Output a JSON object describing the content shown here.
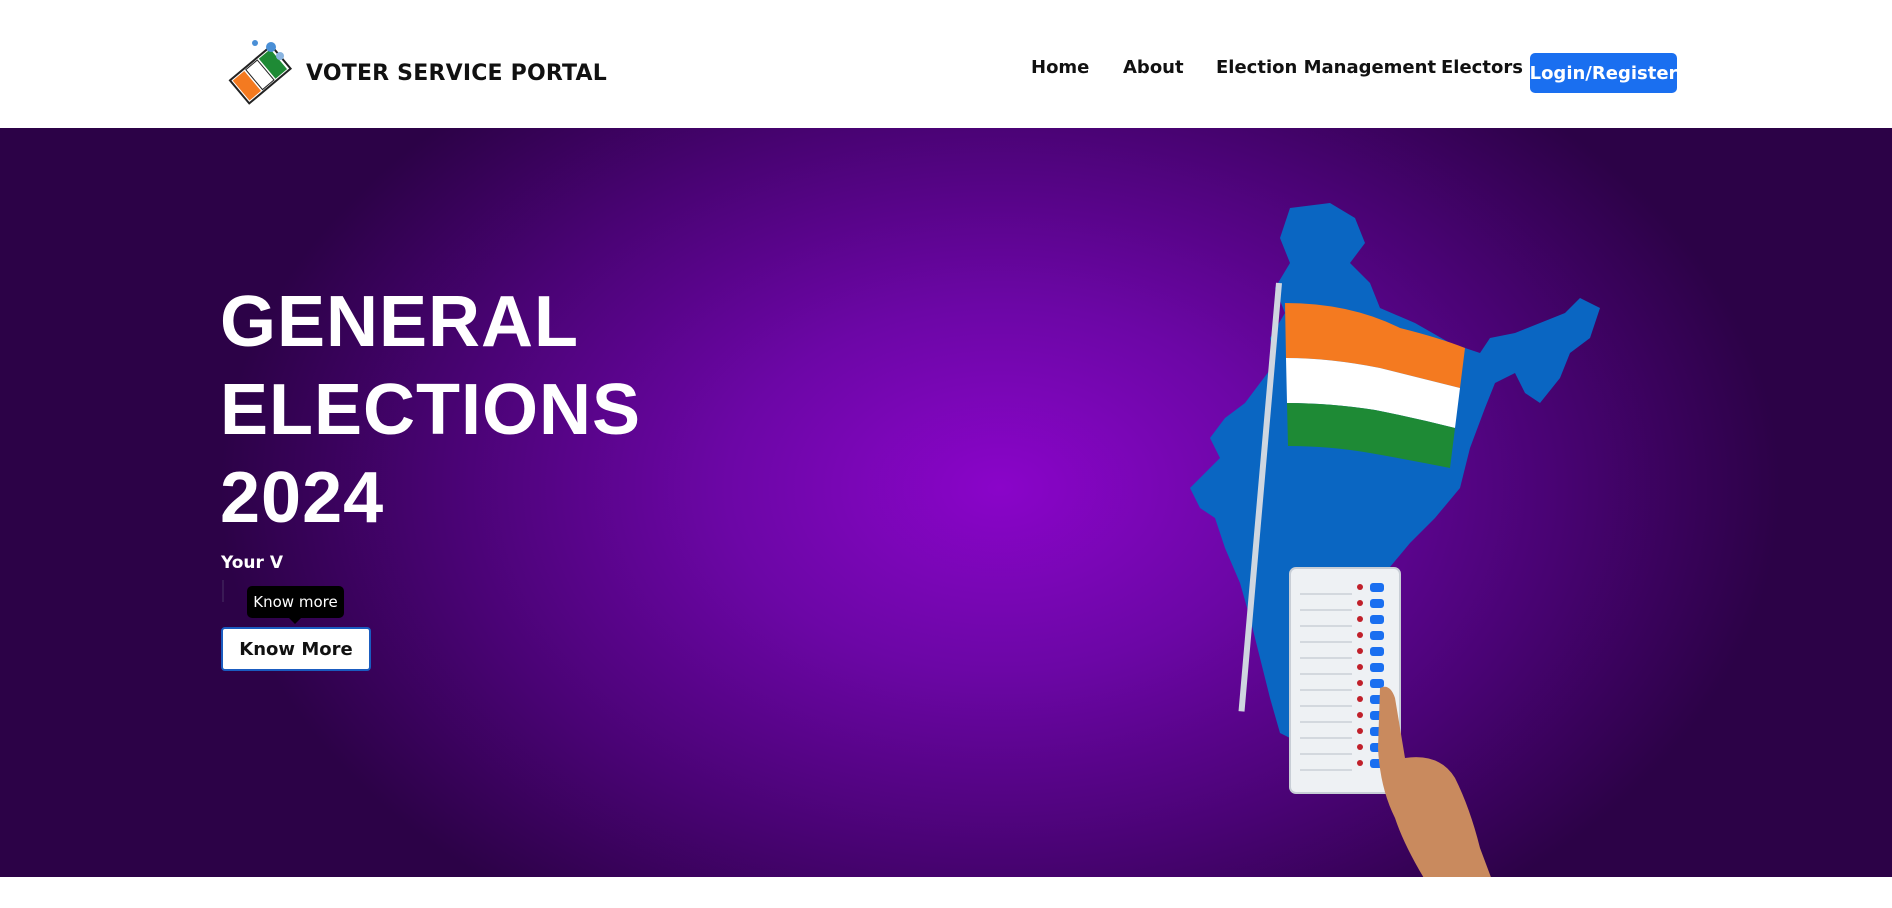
{
  "header": {
    "brand": "VOTER SERVICE PORTAL",
    "logo_icon": "eci-ballot-logo-icon",
    "nav": [
      "Home",
      "About",
      "Election Management",
      "Electors"
    ],
    "login_label": "Login/Register"
  },
  "hero": {
    "title_lines": [
      "GENERAL",
      "ELECTIONS",
      "2024"
    ],
    "subtitle": "Your V",
    "tooltip": "Know more",
    "button": "Know More",
    "illustration_icon": "india-map-flag-evm-icon"
  },
  "colors": {
    "accent": "#1a6ff0",
    "hero_bg": "#7a06b6",
    "saffron": "#f47a20",
    "green": "#1e8a35",
    "map_blue": "#0a66c2"
  }
}
